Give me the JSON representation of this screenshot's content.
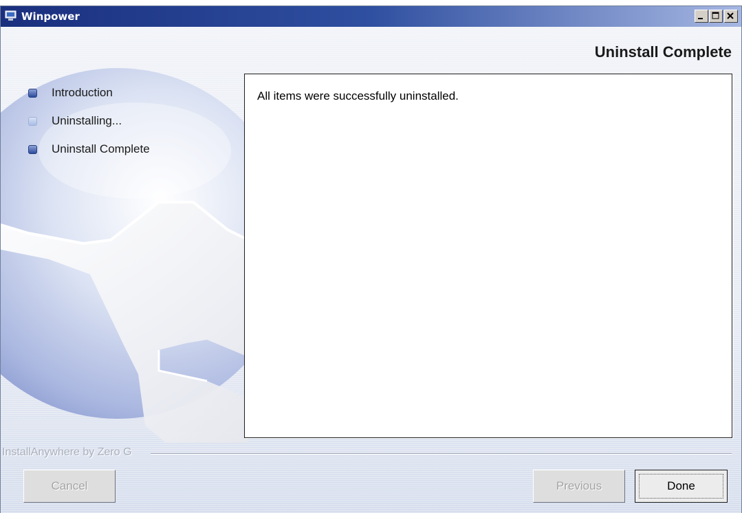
{
  "window": {
    "title": "Winpower",
    "controls": [
      "minimize",
      "maximize",
      "close"
    ]
  },
  "header": {
    "title": "Uninstall Complete"
  },
  "steps": [
    {
      "label": "Introduction",
      "state": "done"
    },
    {
      "label": "Uninstalling...",
      "state": "done"
    },
    {
      "label": "Uninstall Complete",
      "state": "current"
    }
  ],
  "main": {
    "message": "All items were successfully uninstalled."
  },
  "footer": {
    "brand": "InstallAnywhere by Zero G",
    "cancel_label": "Cancel",
    "previous_label": "Previous",
    "done_label": "Done"
  },
  "colors": {
    "titlebar_start": "#1a2f7e",
    "titlebar_end": "#a6b7e2",
    "panel_bg": "#ffffff",
    "window_bg": "#e4e9f2"
  }
}
